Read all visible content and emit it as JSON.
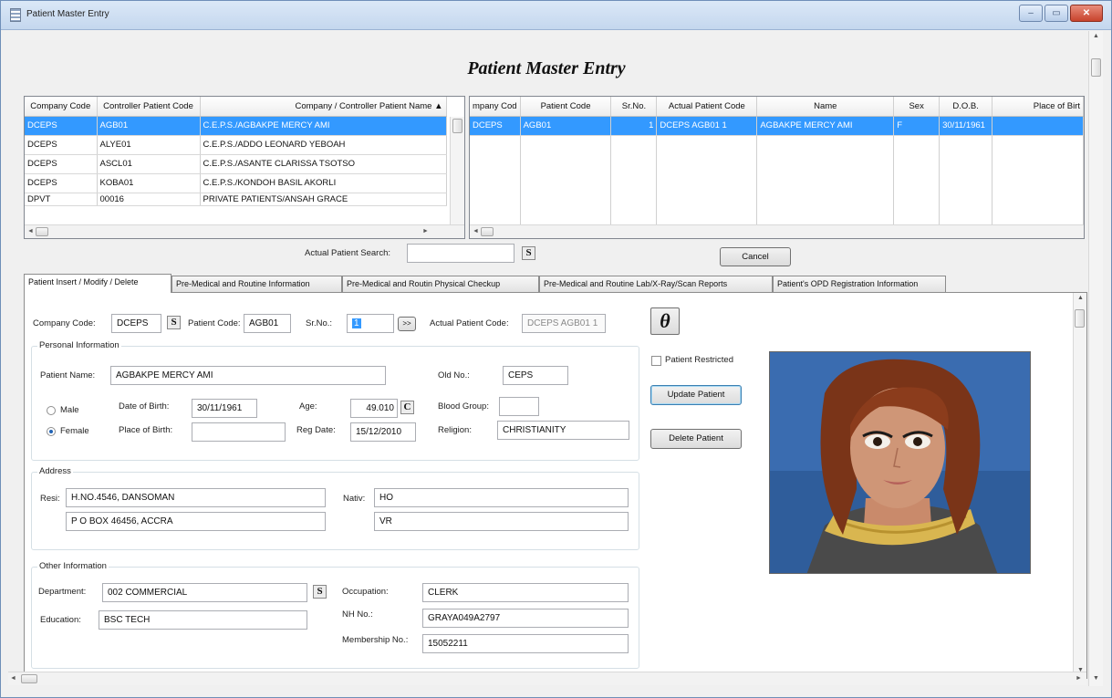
{
  "window": {
    "title": "Patient Master Entry",
    "minimize": "–",
    "maximize": "▭",
    "close": "✕"
  },
  "form_title": "Patient Master Entry",
  "controller_grid": {
    "columns": [
      "Company Code",
      "Controller Patient Code",
      "Company / Controller Patient Name"
    ],
    "rows": [
      [
        "DCEPS",
        "AGB01",
        "C.E.P.S./AGBAKPE MERCY AMI"
      ],
      [
        "DCEPS",
        "ALYE01",
        "C.E.P.S./ADDO LEONARD YEBOAH"
      ],
      [
        "DCEPS",
        "ASCL01",
        "C.E.P.S./ASANTE CLARISSA TSOTSO"
      ],
      [
        "DCEPS",
        "KOBA01",
        "C.E.P.S./KONDOH BASIL AKORLI"
      ],
      [
        "DPVT",
        "00016",
        "PRIVATE PATIENTS/ANSAH GRACE"
      ]
    ]
  },
  "patient_grid": {
    "columns": [
      "mpany Cod",
      "Patient Code",
      "Sr.No.",
      "Actual Patient Code",
      "Name",
      "Sex",
      "D.O.B.",
      "Place of Birt"
    ],
    "rows": [
      [
        "DCEPS",
        "AGB01",
        "1",
        "DCEPS AGB01  1",
        "AGBAKPE MERCY AMI",
        "F",
        "30/11/1961",
        ""
      ]
    ]
  },
  "search": {
    "label": "Actual Patient Search:",
    "value": "",
    "button": "S"
  },
  "cancel_label": "Cancel",
  "tabs": [
    "Patient Insert / Modify / Delete",
    "Pre-Medical and Routine Information",
    "Pre-Medical and Routin Physical Checkup",
    "Pre-Medical and Routine Lab/X-Ray/Scan Reports",
    "Patient's OPD Registration Information"
  ],
  "top_row": {
    "company_code_label": "Company Code:",
    "company_code": "DCEPS",
    "company_btn": "S",
    "patient_code_label": "Patient Code:",
    "patient_code": "AGB01",
    "srno_label": "Sr.No.:",
    "srno": "1",
    "next_btn": ">>",
    "actual_code_label": "Actual Patient Code:",
    "actual_code": "DCEPS AGB01  1",
    "theta": "θ"
  },
  "personal": {
    "title": "Personal Information",
    "name_label": "Patient Name:",
    "name": "AGBAKPE MERCY AMI",
    "old_no_label": "Old No.:",
    "old_no": "CEPS",
    "male": "Male",
    "female": "Female",
    "gender": "Female",
    "dob_label": "Date of Birth:",
    "dob": "30/11/1961",
    "age_label": "Age:",
    "age": "49.010",
    "age_btn": "C",
    "blood_label": "Blood Group:",
    "blood": "",
    "pob_label": "Place of Birth:",
    "pob": "",
    "reg_label": "Reg Date:",
    "reg": "15/12/2010",
    "religion_label": "Religion:",
    "religion": "CHRISTIANITY"
  },
  "address": {
    "title": "Address",
    "resi_label": "Resi:",
    "resi1": "H.NO.4546, DANSOMAN",
    "resi2": "P O BOX 46456, ACCRA",
    "nativ_label": "Nativ:",
    "nativ1": "HO",
    "nativ2": "VR"
  },
  "other": {
    "title": "Other Information",
    "dept_label": "Department:",
    "dept": "002 COMMERCIAL",
    "dept_btn": "S",
    "occ_label": "Occupation:",
    "occ": "CLERK",
    "edu_label": "Education:",
    "edu": "BSC TECH",
    "nh_label": "NH No.:",
    "nh": "GRAYA049A2797",
    "mem_label": "Membership No.:",
    "mem": "15052211"
  },
  "actions": {
    "restricted": "Patient Restricted",
    "update": "Update Patient",
    "delete": "Delete Patient"
  },
  "colors": {
    "selection": "#3399ff",
    "window_frame": "#c4d7ee"
  }
}
